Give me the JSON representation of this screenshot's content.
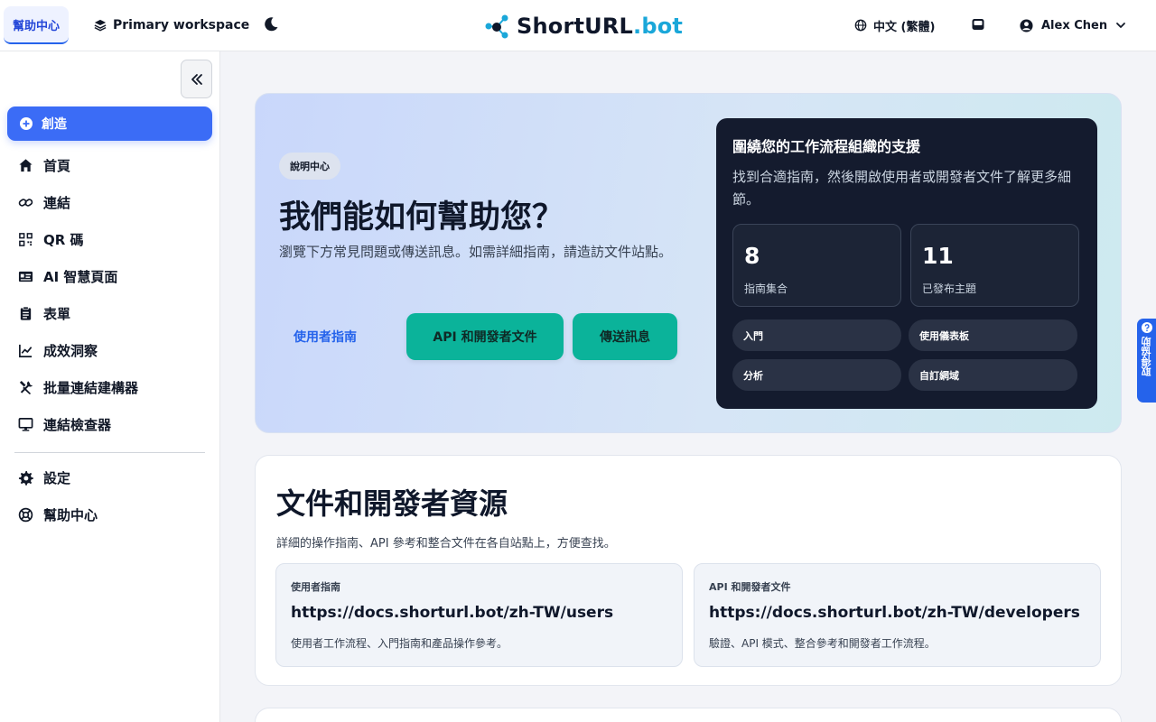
{
  "topbar": {
    "help_tab": "幫助中心",
    "workspace": "Primary workspace",
    "logo": {
      "main": "ShortURL",
      "accent": ".bot"
    },
    "language": "中文 (繁體)",
    "user_name": "Alex Chen"
  },
  "sidebar": {
    "create_label": "創造",
    "items": [
      {
        "label": "首頁",
        "icon": "home-icon"
      },
      {
        "label": "連結",
        "icon": "link-icon"
      },
      {
        "label": "QR 碼",
        "icon": "qr-code-icon"
      },
      {
        "label": "AI 智慧頁面",
        "icon": "id-card-icon"
      },
      {
        "label": "表單",
        "icon": "clipboard-icon"
      },
      {
        "label": "成效洞察",
        "icon": "chart-line-icon"
      },
      {
        "label": "批量連結建構器",
        "icon": "tools-icon"
      },
      {
        "label": "連結檢查器",
        "icon": "monitor-icon"
      }
    ],
    "bottom_items": [
      {
        "label": "設定",
        "icon": "gear-icon"
      },
      {
        "label": "幫助中心",
        "icon": "lifebuoy-icon"
      }
    ]
  },
  "hero": {
    "badge": "說明中心",
    "title": "我們能如何幫助您？",
    "description": "瀏覽下方常見問題或傳送訊息。如需詳細指南，請造訪文件站點。",
    "user_guide_link": "使用者指南",
    "dev_docs_button": "API 和開發者文件",
    "send_message_button": "傳送訊息",
    "panel": {
      "title": "圍繞您的工作流程組織的支援",
      "description": "找到合適指南，然後開啟使用者或開發者文件了解更多細節。",
      "stats": [
        {
          "value": "8",
          "label": "指南集合"
        },
        {
          "value": "11",
          "label": "已發布主題"
        }
      ],
      "chips": [
        "入門",
        "使用儀表板",
        "分析",
        "自訂網域"
      ]
    }
  },
  "docs": {
    "title": "文件和開發者資源",
    "description": "詳細的操作指南、API 參考和整合文件在各自站點上，方便查找。",
    "resources": [
      {
        "label": "使用者指南",
        "url": "https://docs.shorturl.bot/zh-TW/users",
        "description": "使用者工作流程、入門指南和產品操作參考。"
      },
      {
        "label": "API 和開發者文件",
        "url": "https://docs.shorturl.bot/zh-TW/developers",
        "description": "驗證、API 模式、整合參考和開發者工作流程。"
      }
    ]
  },
  "feedback": {
    "label": "取得協助"
  },
  "colors": {
    "primary": "#3b6cf6",
    "teal": "#0bb39a",
    "panel": "#141b2e",
    "logo_accent": "#1aa7d9"
  }
}
